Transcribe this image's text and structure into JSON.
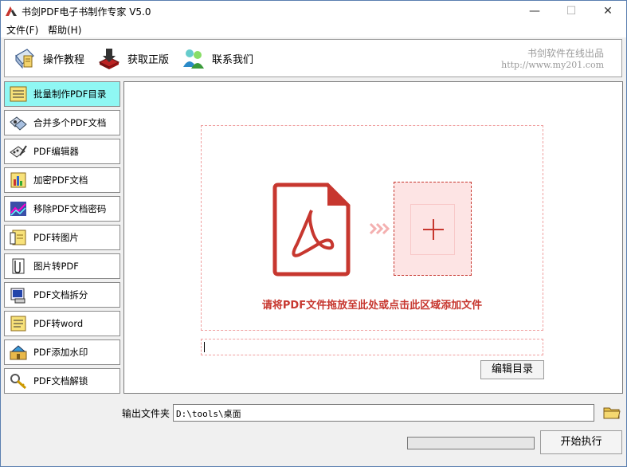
{
  "window": {
    "title": "书剑PDF电子书制作专家 V5.0",
    "minimize": "—",
    "maximize": "☐",
    "close": "✕"
  },
  "menu": [
    {
      "label": "文件(F)"
    },
    {
      "label": "帮助(H)"
    }
  ],
  "toolbar": {
    "items": [
      {
        "label": "操作教程"
      },
      {
        "label": "获取正版"
      },
      {
        "label": "联系我们"
      }
    ],
    "brand_name": "书剑软件在线出品",
    "brand_url": "http://www.my201.com"
  },
  "sidebar": {
    "items": [
      {
        "label": "批量制作PDF目录",
        "icon": "list-icon",
        "active": true
      },
      {
        "label": "合并多个PDF文档",
        "icon": "merge-icon"
      },
      {
        "label": "PDF编辑器",
        "icon": "editor-icon"
      },
      {
        "label": "加密PDF文档",
        "icon": "encrypt-icon"
      },
      {
        "label": "移除PDF文档密码",
        "icon": "remove-password-icon"
      },
      {
        "label": "PDF转图片",
        "icon": "pdf-to-image-icon"
      },
      {
        "label": "图片转PDF",
        "icon": "image-to-pdf-icon"
      },
      {
        "label": "PDF文档拆分",
        "icon": "split-icon"
      },
      {
        "label": "PDF转word",
        "icon": "pdf-to-word-icon"
      },
      {
        "label": "PDF添加水印",
        "icon": "watermark-icon"
      },
      {
        "label": "PDF文档解锁",
        "icon": "unlock-icon"
      }
    ]
  },
  "main": {
    "drop_text": "请将PDF文件拖放至此处或点击此区域添加文件",
    "file_path_value": "",
    "edit_toc_label": "编辑目录"
  },
  "footer": {
    "output_label": "输出文件夹",
    "output_value": "D:\\tools\\桌面",
    "start_label": "开始执行",
    "progress": 0
  },
  "colors": {
    "accent": "#c7372f",
    "active_item": "#8ff7f3",
    "dashed_border": "#f0a0a0"
  }
}
